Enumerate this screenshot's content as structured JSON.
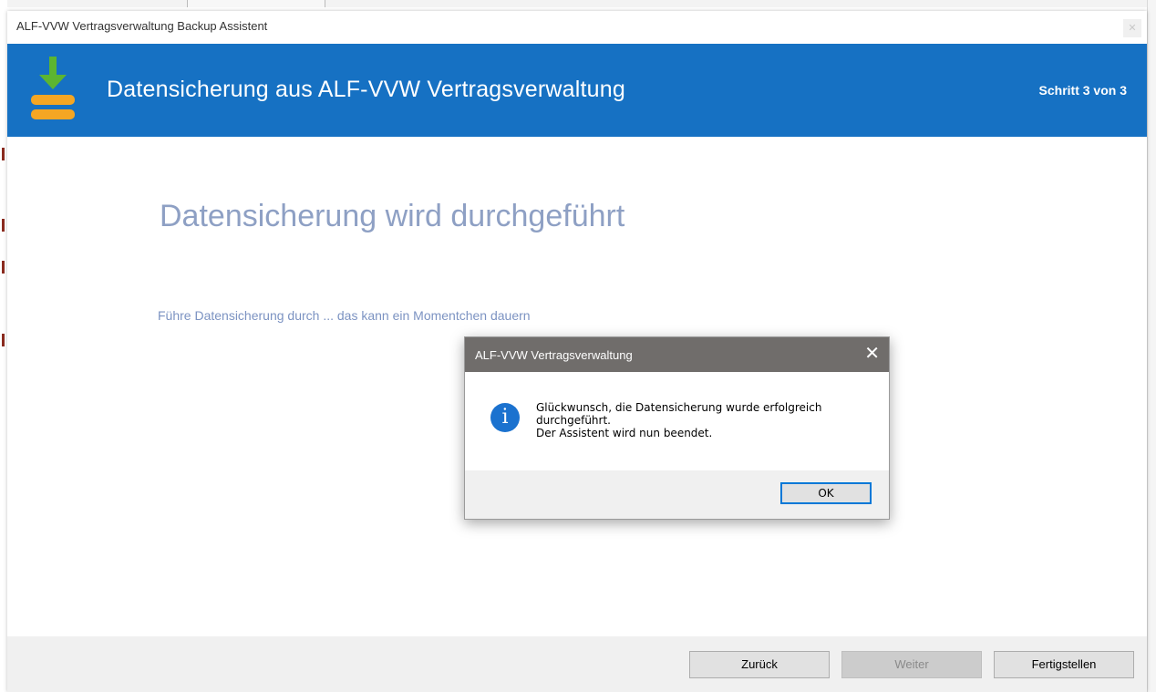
{
  "window": {
    "title": "ALF-VVW Vertragsverwaltung Backup Assistent",
    "close_glyph": "✕"
  },
  "banner": {
    "title": "Datensicherung aus ALF-VVW Vertragsverwaltung",
    "step": "Schritt 3 von 3",
    "icon": "backup-download-icon",
    "color": "#1671c3"
  },
  "content": {
    "heading": "Datensicherung wird durchgeführt",
    "status": "Führe Datensicherung durch ... das kann ein Momentchen dauern"
  },
  "footer": {
    "back_label": "Zurück",
    "next_label": "Weiter",
    "finish_label": "Fertigstellen"
  },
  "dialog": {
    "title": "ALF-VVW Vertragsverwaltung",
    "close_glyph": "✕",
    "icon": "info-icon",
    "icon_glyph": "i",
    "message_line1": "Glückwunsch, die Datensicherung wurde erfolgreich",
    "message_line2": "durchgeführt.",
    "message_line3": "Der Assistent wird nun beendet.",
    "ok_label": "OK"
  }
}
